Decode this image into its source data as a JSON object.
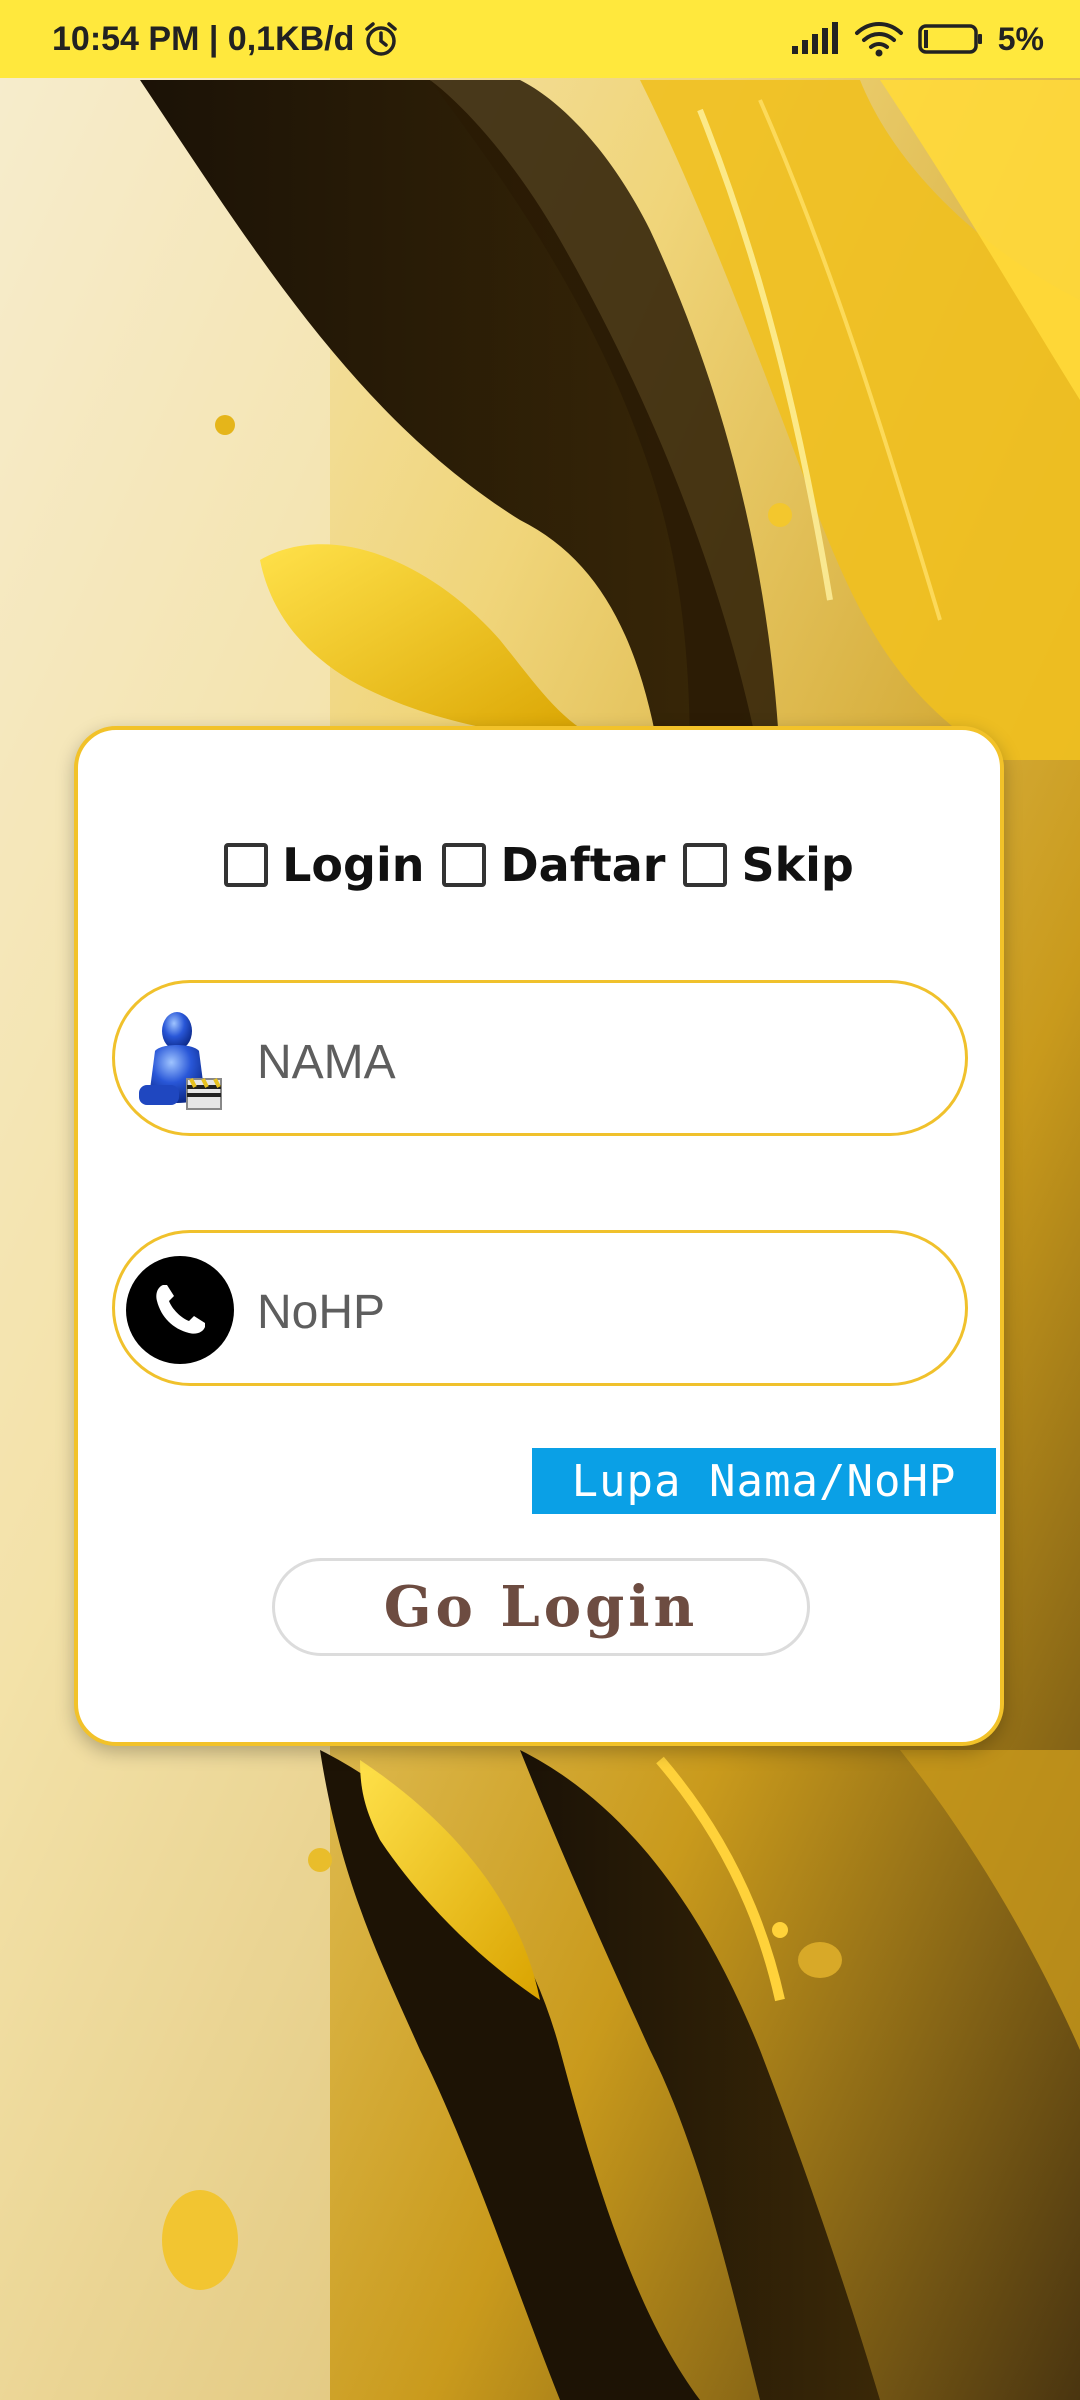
{
  "status_bar": {
    "time_info": "10:54 PM | 0,1KB/d",
    "battery": "5%",
    "icons": [
      "alarm-icon",
      "signal-icon",
      "wifi-icon",
      "battery-icon"
    ]
  },
  "login_card": {
    "modes": [
      {
        "label": "Login",
        "checked": false
      },
      {
        "label": "Daftar",
        "checked": false
      },
      {
        "label": "Skip",
        "checked": false
      }
    ],
    "name_field": {
      "placeholder": "NAMA",
      "value": "",
      "icon": "user-icon"
    },
    "phone_field": {
      "placeholder": "NoHP",
      "value": "",
      "icon": "phone-icon"
    },
    "forgot_link": "Lupa Nama/NoHP",
    "submit_button": "Go Login"
  },
  "colors": {
    "status_bar": "#ffe83d",
    "card_border": "#f2c229",
    "forgot_bg": "#0aa0e6",
    "button_text": "#6d4c41"
  }
}
